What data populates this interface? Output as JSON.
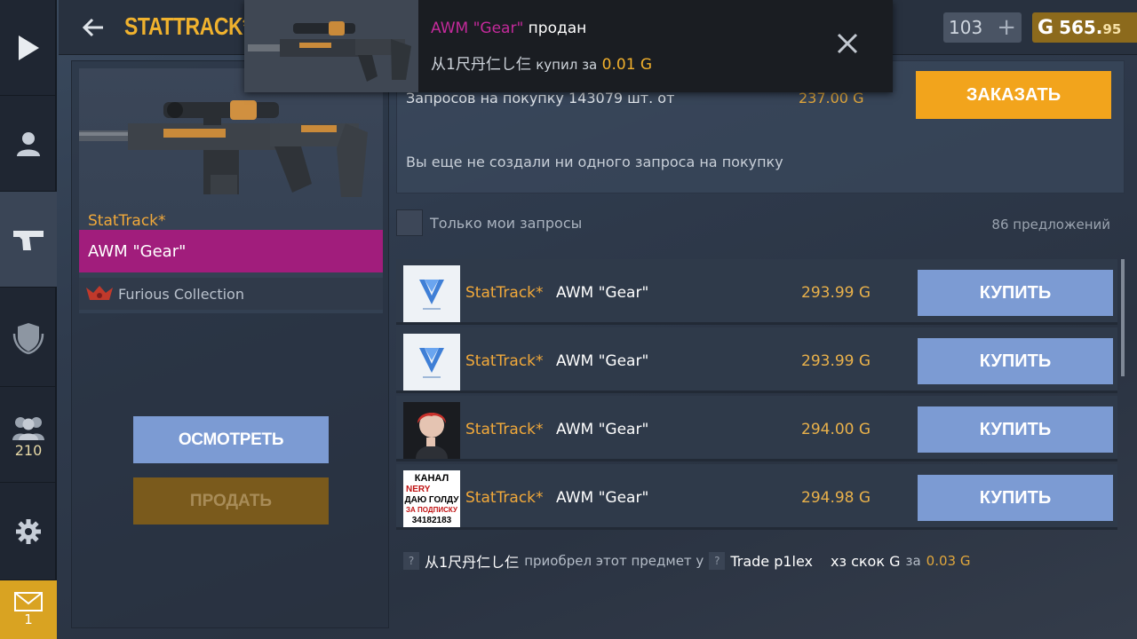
{
  "header": {
    "title": "STATTRACK* A",
    "currency_silver": "103",
    "currency_gold_symbol": "G",
    "currency_gold_int": "565.",
    "currency_gold_dec": "95",
    "plus": "+"
  },
  "sidebar": {
    "friends_count": "210",
    "mail_count": "1"
  },
  "item": {
    "stattrak_label": "StatTrack*",
    "name": "AWM \"Gear\"",
    "collection": "Furious Collection",
    "inspect_label": "ОСМОТРЕТЬ",
    "sell_label": "ПРОДАТЬ"
  },
  "requests": {
    "text": "Запросов на покупку 143079 шт. от",
    "price": "237.00 G",
    "order_label": "ЗАКАЗАТЬ",
    "empty_text": "Вы еще не создали ни одного запроса на покупку",
    "only_mine_label": "Только мои запросы",
    "offers_count": "86 предложений"
  },
  "offers": [
    {
      "stattrak": "StatTrack*",
      "name": "AWM \"Gear\"",
      "price": "293.99 G",
      "buy_label": "КУПИТЬ"
    },
    {
      "stattrak": "StatTrack*",
      "name": "AWM \"Gear\"",
      "price": "293.99 G",
      "buy_label": "КУПИТЬ"
    },
    {
      "stattrak": "StatTrack*",
      "name": "AWM \"Gear\"",
      "price": "294.00 G",
      "buy_label": "КУПИТЬ"
    },
    {
      "stattrak": "StatTrack*",
      "name": "AWM \"Gear\"",
      "price": "294.98 G",
      "buy_label": "КУПИТЬ"
    }
  ],
  "avatar4_text": [
    "КАНАЛ",
    "NERY",
    "ДАЮ ГОЛДУ",
    "ЗА ПОДПИСКУ",
    "34182183"
  ],
  "footer": {
    "qmark": "?",
    "buyer": "从1尺丹仁し仨",
    "acquired": "приобрел этот предмет у",
    "seller": "Trade p1lex",
    "seller2": "хз скок G",
    "for": "за",
    "price": "0.03 G"
  },
  "notification": {
    "item": "AWM \"Gear\"",
    "sold": "продан",
    "buyer": "从1尺丹仁し仨",
    "bought_for": "купил за",
    "price": "0.01 G"
  },
  "colors": {
    "accent_gold": "#f2a41c",
    "item_name_bar": "#a11d7c",
    "buy_button": "#7c9bd3"
  }
}
